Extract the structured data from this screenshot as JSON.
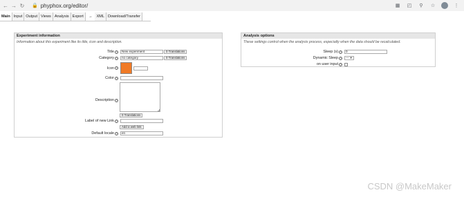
{
  "browser": {
    "url": "phyphox.org/editor/",
    "back_icon": "arrow-left",
    "forward_icon": "arrow-right",
    "reload_icon": "reload"
  },
  "tabs": [
    {
      "label": "Main",
      "active": true
    },
    {
      "label": "Input"
    },
    {
      "label": "Output"
    },
    {
      "label": "Views"
    },
    {
      "label": "Analysis"
    },
    {
      "label": "Export"
    },
    {
      "label": "→"
    },
    {
      "label": "XML"
    },
    {
      "label": "Download/Transfer"
    }
  ],
  "experiment": {
    "title": "Experiment information",
    "description": "Information about this experiment like its title, icon and description.",
    "fields": {
      "title_label": "Title",
      "title_value": "New experiment",
      "title_translations": "0 Translations",
      "category_label": "Category",
      "category_value": "no category",
      "category_translations": "0 Translations",
      "icon_label": "Icon",
      "color_label": "Color",
      "description_label": "Description",
      "description_translations": "0 Translations",
      "link_label": "Label of new Link",
      "link_button": "Add a web link",
      "locale_label": "Default locale",
      "locale_value": "en",
      "icon_color": "#f07a26"
    }
  },
  "analysis": {
    "title": "Analysis options",
    "description": "These settings control when the analysis process, especially when the data should be recalculated.",
    "sleep_label": "Sleep (s)",
    "sleep_value": "0",
    "dynamic_sleep_label": "Dynamic Sleep",
    "dynamic_sleep_value": "---",
    "on_user_input_label": "on user input"
  },
  "watermark": "CSDN @MakeMaker"
}
